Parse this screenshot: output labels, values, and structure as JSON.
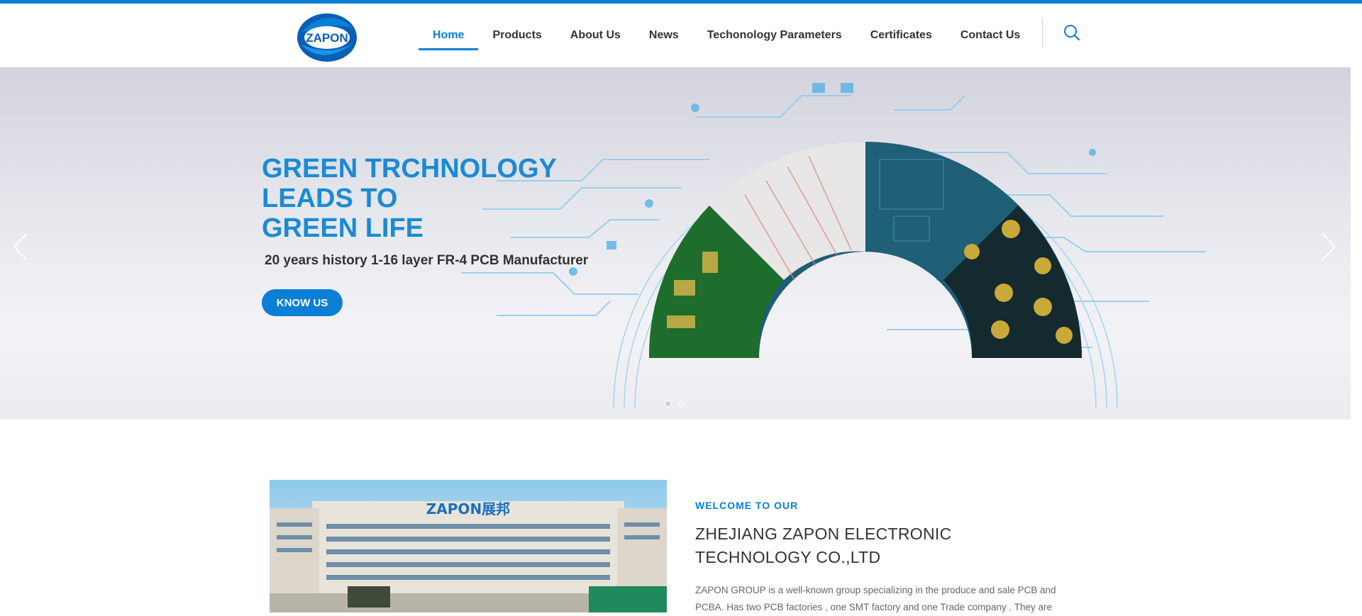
{
  "brand": {
    "logo_text": "ZAPON",
    "accent": "#0a7fd6"
  },
  "nav": {
    "items": [
      {
        "label": "Home",
        "active": true
      },
      {
        "label": "Products"
      },
      {
        "label": "About Us"
      },
      {
        "label": "News"
      },
      {
        "label": "Techonology Parameters"
      },
      {
        "label": "Certificates"
      },
      {
        "label": "Contact Us"
      }
    ],
    "search_icon": "search-icon"
  },
  "hero": {
    "title_lines": [
      "GREEN TRCHNOLOGY",
      "LEADS TO",
      "GREEN LIFE"
    ],
    "subtitle": "20 years history 1-16 layer FR-4 PCB Manufacturer",
    "button": "KNOW US",
    "prev_icon": "chevron-left-icon",
    "next_icon": "chevron-right-icon",
    "slides": 2,
    "active_slide": 1
  },
  "about": {
    "image_sign": "ZAPON展邦",
    "eyebrow": "WELCOME TO OUR",
    "company_line1": "ZHEJIANG ZAPON ELECTRONIC",
    "company_line2": "TECHNOLOGY CO.,LTD",
    "description": "ZAPON GROUP is a well-known group specializing in the produce and sale PCB and PCBA. Has two PCB factories , one SMT factory and one Trade company . They are"
  }
}
